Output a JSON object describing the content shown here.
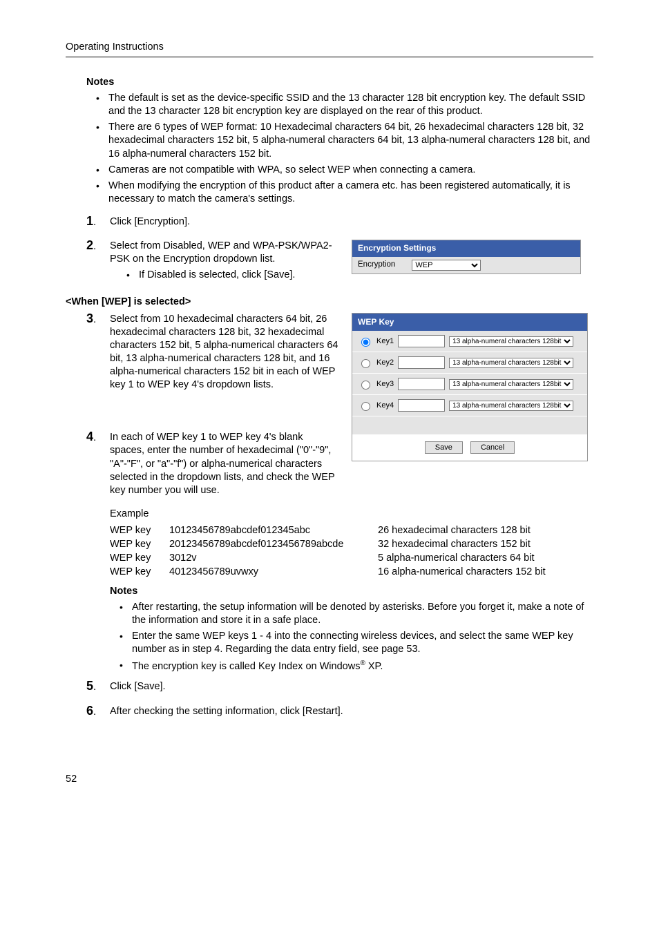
{
  "header": "Operating Instructions",
  "notes_label": "Notes",
  "notes_top": [
    "The default is set as the device-specific SSID and the 13 character 128 bit encryption key. The default SSID and the 13 character 128 bit encryption key are displayed on the rear of this product.",
    "There are 6 types of WEP format: 10 Hexadecimal characters 64 bit, 26 hexadecimal characters 128 bit, 32 hexadecimal characters 152 bit, 5 alpha-numeral characters 64 bit, 13 alpha-numeral characters 128 bit, and 16 alpha-numeral characters 152 bit.",
    "Cameras are not compatible with WPA, so select WEP when connecting a camera.",
    "When modifying the encryption of this product after a camera etc. has been registered automatically, it is necessary to match the camera's settings."
  ],
  "steps": {
    "s1": "Click [Encryption].",
    "s2": "Select from Disabled, WEP and WPA-PSK/WPA2-PSK on the Encryption dropdown list.",
    "s2_sub": "If Disabled is selected, click [Save].",
    "s3": "Select from 10 hexadecimal characters 64 bit, 26 hexadecimal characters 128 bit, 32 hexadecimal characters 152 bit, 5 alpha-numerical characters 64 bit, 13 alpha-numerical characters 128 bit, and 16 alpha-numerical characters 152 bit in each of WEP key 1 to WEP key 4's dropdown lists.",
    "s4": "In each of WEP key 1 to WEP key 4's blank spaces, enter the number of hexadecimal (\"0\"-\"9\", \"A\"-\"F\", or \"a\"-\"f\") or alpha-numerical characters selected in the dropdown lists, and check the WEP key number you will use.",
    "s5": "Click [Save].",
    "s6": "After checking the setting information, click [Restart]."
  },
  "when_wep": "<When [WEP] is selected>",
  "enc_panel": {
    "title": "Encryption Settings",
    "label": "Encryption",
    "value": "WEP"
  },
  "wep_panel": {
    "title": "WEP Key",
    "rows": [
      {
        "label": "Key1",
        "select": "13 alpha-numeral characters 128bit"
      },
      {
        "label": "Key2",
        "select": "13 alpha-numeral characters 128bit"
      },
      {
        "label": "Key3",
        "select": "13 alpha-numeral characters 128bit"
      },
      {
        "label": "Key4",
        "select": "13 alpha-numeral characters 128bit"
      }
    ],
    "save": "Save",
    "cancel": "Cancel"
  },
  "example": {
    "label": "Example",
    "rows": [
      {
        "c1": "WEP key",
        "c2": "10123456789abcdef012345abc",
        "c3": "26 hexadecimal characters 128 bit"
      },
      {
        "c1": "WEP key",
        "c2": "20123456789abcdef0123456789abcde",
        "c3": "32 hexadecimal characters 152 bit"
      },
      {
        "c1": "WEP key",
        "c2": "3012v",
        "c3": "5 alpha-numerical characters 64 bit"
      },
      {
        "c1": "WEP key",
        "c2": "40123456789uvwxy",
        "c3": "16 alpha-numerical characters 152 bit"
      }
    ]
  },
  "notes_bottom": [
    "After restarting, the setup information will be denoted by asterisks. Before you forget it, make a note of the information and store it in a safe place.",
    "Enter the same WEP keys 1 - 4 into the connecting wireless devices, and select the same WEP key number as in step 4. Regarding the data entry field, see page 53."
  ],
  "note_key_index_pre": "The encryption key is called Key Index on Windows",
  "note_key_index_post": " XP.",
  "page_num": "52"
}
